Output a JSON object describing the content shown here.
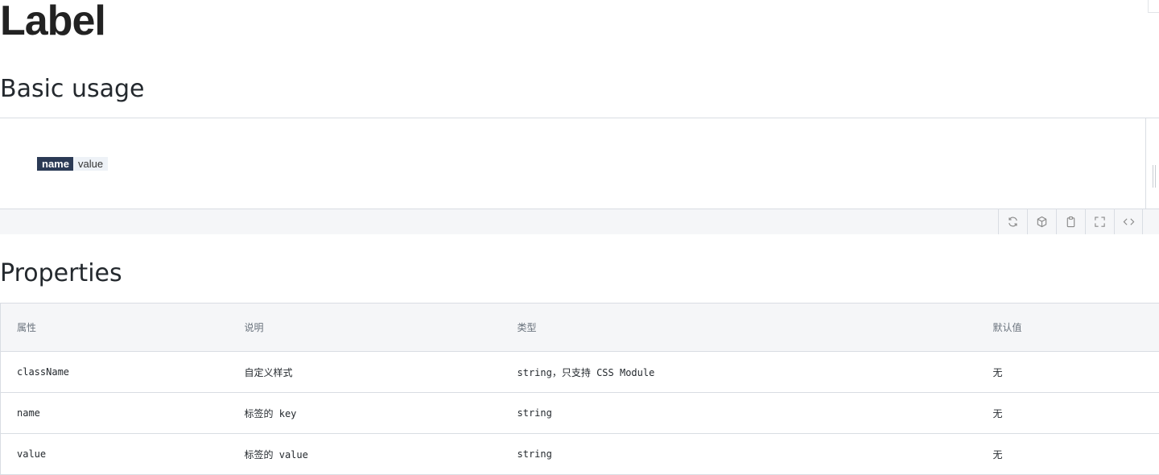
{
  "page": {
    "title": "Label"
  },
  "sections": {
    "basic_usage": "Basic usage",
    "properties": "Properties"
  },
  "demo": {
    "label": {
      "name": "name",
      "value": "value"
    },
    "toolbar": [
      {
        "icon": "refresh-icon",
        "name": "refresh-button"
      },
      {
        "icon": "cube-icon",
        "name": "codesandbox-button"
      },
      {
        "icon": "clipboard-icon",
        "name": "copy-button"
      },
      {
        "icon": "fullscreen-icon",
        "name": "fullscreen-button"
      },
      {
        "icon": "code-icon",
        "name": "show-code-button"
      }
    ]
  },
  "table": {
    "headers": [
      "属性",
      "说明",
      "类型",
      "默认值"
    ],
    "rows": [
      [
        "className",
        "自定义样式",
        "string，只支持 CSS Module",
        "无"
      ],
      [
        "name",
        "标签的 key",
        "string",
        "无"
      ],
      [
        "value",
        "标签的 value",
        "string",
        "无"
      ]
    ]
  },
  "colors": {
    "label_name_bg": "#2b3a55",
    "label_value_bg": "#eef2f7",
    "toolbar_bg": "#f5f6f8",
    "border": "#d9dde3"
  }
}
